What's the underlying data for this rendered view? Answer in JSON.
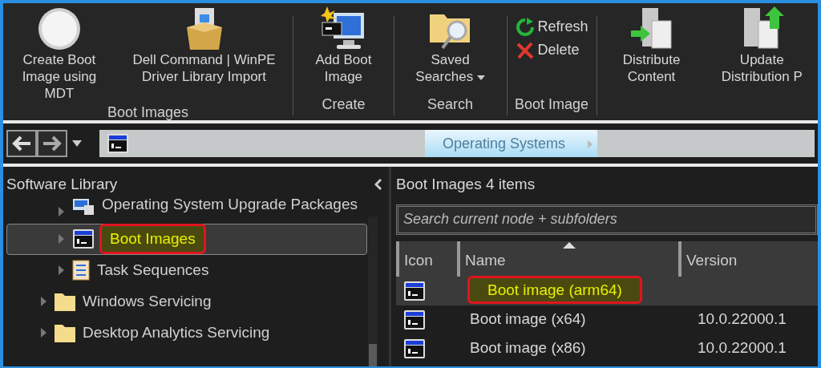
{
  "ribbon": {
    "groups": [
      {
        "label": "Boot Images",
        "buttons": [
          {
            "label": "Create Boot Image using MDT",
            "kind": "large"
          },
          {
            "label": "Dell Command | WinPE Driver Library Import",
            "kind": "large"
          }
        ]
      },
      {
        "label": "Create",
        "buttons": [
          {
            "label": "Add Boot Image",
            "kind": "large"
          }
        ]
      },
      {
        "label": "Search",
        "buttons": [
          {
            "label": "Saved Searches",
            "kind": "large",
            "dropdown": true
          }
        ]
      },
      {
        "label": "Boot Image",
        "buttons": [
          {
            "label": "Refresh",
            "kind": "small"
          },
          {
            "label": "Delete",
            "kind": "small"
          }
        ]
      },
      {
        "buttons": [
          {
            "label": "Distribute Content",
            "kind": "large"
          },
          {
            "label": "Update Distribution P",
            "kind": "large"
          }
        ]
      }
    ]
  },
  "breadcrumb": [
    {
      "label": "Operating Systems",
      "selected": true
    }
  ],
  "sidebar": {
    "title": "Software Library",
    "items": [
      {
        "kind": "group",
        "children": [
          {
            "label": "Operating System Upgrade Packages",
            "expanded": false,
            "selected": false,
            "annotated": false
          },
          {
            "label": "Boot Images",
            "expanded": false,
            "selected": true,
            "annotated": true
          },
          {
            "label": "Task Sequences",
            "expanded": false,
            "selected": false,
            "annotated": false
          }
        ]
      },
      {
        "label": "Windows Servicing",
        "expanded": false,
        "selected": false,
        "annotated": false
      },
      {
        "label": "Desktop Analytics Servicing",
        "expanded": false,
        "selected": false,
        "annotated": false
      }
    ]
  },
  "list": {
    "title": "Boot Images 4 items",
    "search": {
      "placeholder": "Search current node + subfolders"
    },
    "columns": [
      {
        "label": "Icon",
        "sorted": false
      },
      {
        "label": "Name",
        "sorted": true
      },
      {
        "label": "Version",
        "sorted": false
      }
    ],
    "rows": [
      {
        "name": "Boot image (arm64)",
        "selected": true,
        "annotated": true
      },
      {
        "name": "Boot image (x64)",
        "version": "10.0.22000.1",
        "selected": false,
        "annotated": false
      },
      {
        "name": "Boot image (x86)",
        "version": "10.0.22000.1",
        "selected": false,
        "annotated": false
      }
    ]
  }
}
